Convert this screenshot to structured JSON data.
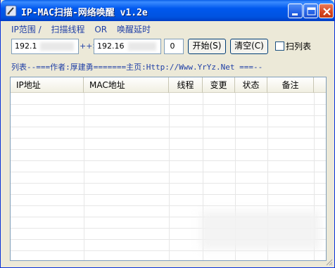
{
  "window": {
    "title": "IP-MAC扫描-网络唤醒 v1.2e",
    "icon": "broom-icon",
    "controls": [
      "minimize-icon",
      "maximize-icon",
      "close-icon"
    ]
  },
  "menu": {
    "items": [
      "IP范围 /",
      "扫描线程",
      "OR",
      "唤醒延时"
    ]
  },
  "range": {
    "start_ip": "192.1",
    "arrow": "++>",
    "end_ip": "192.16",
    "threads": "0"
  },
  "buttons": {
    "start": "开始(S)",
    "clear": "清空(C)"
  },
  "checkbox": {
    "label": "扫列表",
    "checked": false
  },
  "list_caption": "列表--===作者:厚建勇=======主页:Http://Www.YrYz.Net ===--",
  "table": {
    "columns": [
      "IP地址",
      "MAC地址",
      "线程",
      "变更",
      "状态",
      "备注"
    ],
    "rows": []
  },
  "colors": {
    "title_bar": "#0058ee",
    "caption_text": "#1f3fa6",
    "window_bg": "#ece9d8"
  }
}
